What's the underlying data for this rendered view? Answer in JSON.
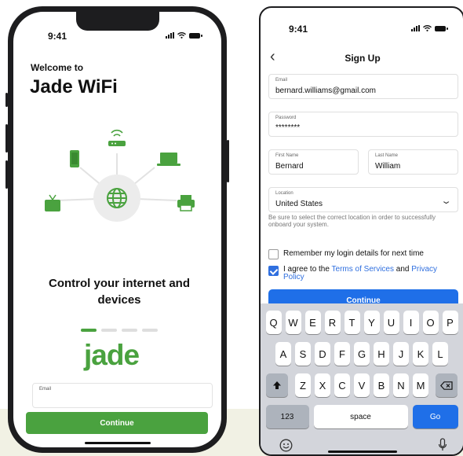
{
  "status_time": "9:41",
  "welcome_screen": {
    "welcome_text": "Welcome to",
    "app_title": "Jade WiFi",
    "tagline": "Control your internet and devices",
    "logo_text": "jade",
    "email_label": "Email",
    "continue_label": "Continue",
    "carousel": {
      "total": 4,
      "active": 1
    }
  },
  "signup_screen": {
    "title": "Sign Up",
    "email": {
      "label": "Email",
      "value": "bernard.williams@gmail.com"
    },
    "password": {
      "label": "Password",
      "value": "********"
    },
    "first_name": {
      "label": "First Name",
      "value": "Bernard"
    },
    "last_name": {
      "label": "Last Name",
      "value": "William"
    },
    "location": {
      "label": "Location",
      "value": "United States"
    },
    "location_hint": "Be sure to select the correct location in order to successfully onboard your system.",
    "remember": {
      "label": "Remember my login details for next time",
      "checked": false
    },
    "agree": {
      "prefix": "I agree to the ",
      "terms_link": "Terms of Services",
      "middle": " and ",
      "privacy_link": "Privacy Policy",
      "checked": true
    },
    "continue_label": "Continue"
  },
  "keyboard": {
    "row1": [
      "Q",
      "W",
      "E",
      "R",
      "T",
      "Y",
      "U",
      "I",
      "O",
      "P"
    ],
    "row2": [
      "A",
      "S",
      "D",
      "F",
      "G",
      "H",
      "J",
      "K",
      "L"
    ],
    "row3": [
      "Z",
      "X",
      "C",
      "V",
      "B",
      "N",
      "M"
    ],
    "numbers_key": "123",
    "space_key": "space",
    "go_key": "Go"
  },
  "colors": {
    "jade_green": "#4aa23f",
    "link_blue": "#2f6fdf",
    "button_blue": "#1f6fe8"
  }
}
